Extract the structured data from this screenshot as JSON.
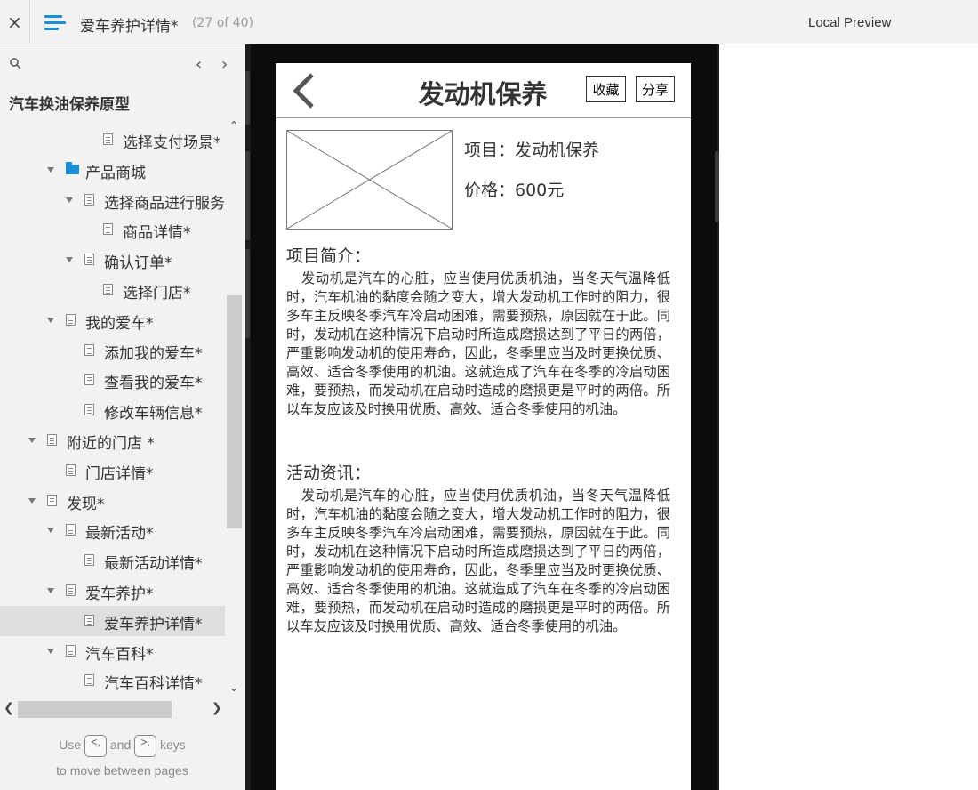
{
  "topbar": {
    "close_label": "×",
    "page_title": "爱车养护详情*",
    "page_count": "(27 of 40)",
    "local_preview": "Local Preview"
  },
  "sidebar": {
    "prev_label": "‹",
    "next_label": "›",
    "project_title": "汽车换油保养原型",
    "items": [
      {
        "label": "选择支付场景*",
        "level": 3,
        "type": "page",
        "expanded": null,
        "selected": false
      },
      {
        "label": "产品商城",
        "level": 1,
        "type": "folder",
        "expanded": true,
        "selected": false
      },
      {
        "label": "选择商品进行服务",
        "level": 2,
        "type": "page",
        "expanded": true,
        "selected": false
      },
      {
        "label": "商品详情*",
        "level": 3,
        "type": "page",
        "expanded": null,
        "selected": false
      },
      {
        "label": "确认订单*",
        "level": 2,
        "type": "page",
        "expanded": true,
        "selected": false
      },
      {
        "label": "选择门店*",
        "level": 3,
        "type": "page",
        "expanded": null,
        "selected": false
      },
      {
        "label": "我的爱车*",
        "level": 1,
        "type": "page",
        "expanded": true,
        "selected": false
      },
      {
        "label": "添加我的爱车*",
        "level": 2,
        "type": "page",
        "expanded": null,
        "selected": false
      },
      {
        "label": "查看我的爱车*",
        "level": 2,
        "type": "page",
        "expanded": null,
        "selected": false
      },
      {
        "label": "修改车辆信息*",
        "level": 2,
        "type": "page",
        "expanded": null,
        "selected": false
      },
      {
        "label": "附近的门店 *",
        "level": 0,
        "type": "page",
        "expanded": true,
        "selected": false
      },
      {
        "label": "门店详情*",
        "level": 1,
        "type": "page",
        "expanded": null,
        "selected": false
      },
      {
        "label": "发现*",
        "level": 0,
        "type": "page",
        "expanded": true,
        "selected": false
      },
      {
        "label": "最新活动*",
        "level": 1,
        "type": "page",
        "expanded": true,
        "selected": false
      },
      {
        "label": "最新活动详情*",
        "level": 2,
        "type": "page",
        "expanded": null,
        "selected": false
      },
      {
        "label": "爱车养护*",
        "level": 1,
        "type": "page",
        "expanded": true,
        "selected": false
      },
      {
        "label": "爱车养护详情*",
        "level": 2,
        "type": "page",
        "expanded": null,
        "selected": true
      },
      {
        "label": "汽车百科*",
        "level": 1,
        "type": "page",
        "expanded": true,
        "selected": false
      },
      {
        "label": "汽车百科详情*",
        "level": 2,
        "type": "page",
        "expanded": null,
        "selected": false
      }
    ],
    "hint_use": "Use",
    "hint_and": "and",
    "hint_keys": "keys",
    "hint_line2": "to move between pages",
    "key_prev": "<,",
    "key_next": ">."
  },
  "app": {
    "title": "发动机保养",
    "fav_label": "收藏",
    "share_label": "分享",
    "item_name": "项目：发动机保养",
    "item_price": "价格：600元",
    "intro_title": "项目简介：",
    "intro_text": "发动机是汽车的心脏，应当使用优质机油，当冬天气温降低时，汽车机油的黏度会随之变大，增大发动机工作时的阻力，很多车主反映冬季汽车冷启动困难，需要预热，原因就在于此。同时，发动机在这种情况下启动时所造成磨损达到了平日的两倍，严重影响发动机的使用寿命，因此，冬季里应当及时更换优质、高效、适合冬季使用的机油。这就造成了汽车在冬季的冷启动困难，要预热，而发动机在启动时造成的磨损更是平时的两倍。所以车友应该及时换用优质、高效、适合冬季使用的机油。",
    "news_title": "活动资讯：",
    "news_text": "发动机是汽车的心脏，应当使用优质机油，当冬天气温降低时，汽车机油的黏度会随之变大，增大发动机工作时的阻力，很多车主反映冬季汽车冷启动困难，需要预热，原因就在于此。同时，发动机在这种情况下启动时所造成磨损达到了平日的两倍，严重影响发动机的使用寿命，因此，冬季里应当及时更换优质、高效、适合冬季使用的机油。这就造成了汽车在冬季的冷启动困难，要预热，而发动机在启动时造成的磨损更是平时的两倍。所以车友应该及时换用优质、高效、适合冬季使用的机油。"
  },
  "colors": {
    "accent": "#1a8fd8",
    "sidebar_bg": "#f2f2f2",
    "selected_bg": "#dedede",
    "phone_frame": "#1c1c1c"
  }
}
